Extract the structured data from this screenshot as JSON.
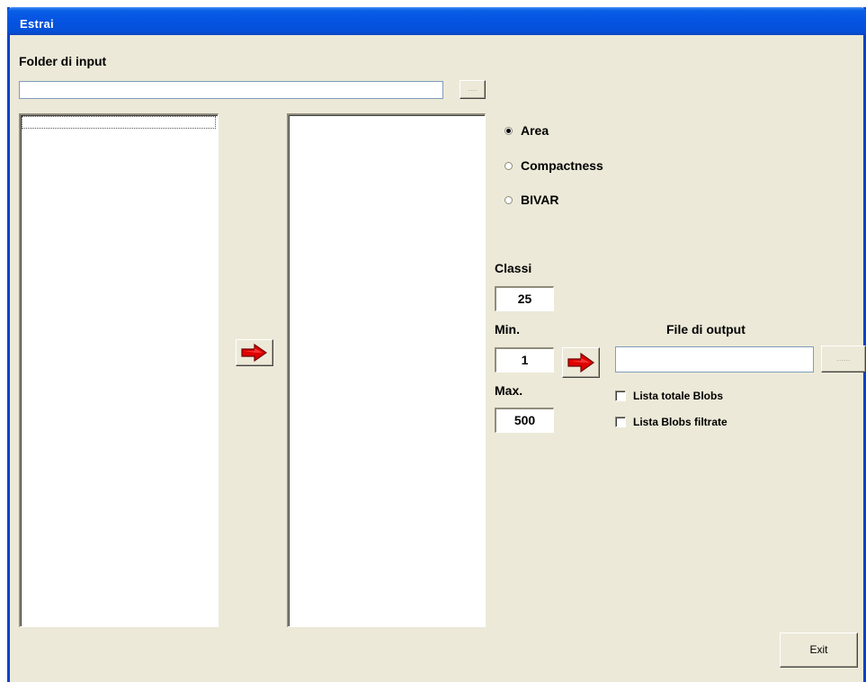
{
  "window": {
    "title": "Estrai"
  },
  "input": {
    "label": "Folder di input",
    "path_value": "",
    "browse_label": "...."
  },
  "lists": {
    "left_items": [],
    "right_items": []
  },
  "measure": {
    "options": [
      {
        "label": "Area",
        "selected": true
      },
      {
        "label": "Compactness",
        "selected": false
      },
      {
        "label": "BIVAR",
        "selected": false
      }
    ]
  },
  "params": {
    "classi_label": "Classi",
    "classi_value": "25",
    "min_label": "Min.",
    "min_value": "1",
    "max_label": "Max.",
    "max_value": "500"
  },
  "output": {
    "label": "File di output",
    "path_value": "",
    "browse_label": "......",
    "checkboxes": [
      {
        "label": "Lista totale Blobs",
        "checked": false
      },
      {
        "label": "Lista Blobs filtrate",
        "checked": false
      }
    ]
  },
  "footer": {
    "exit_label": "Exit"
  },
  "colors": {
    "face": "#ece9d8",
    "titlebar": "#0554e3",
    "arrow": "#e00000"
  },
  "icons": {
    "transfer": "right-arrow-icon",
    "compute": "right-arrow-icon"
  }
}
